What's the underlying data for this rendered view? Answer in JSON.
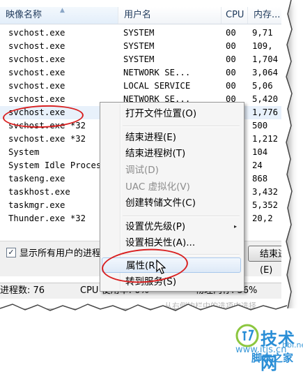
{
  "columns": {
    "name": "映像名称",
    "user": "用户名",
    "cpu": "CPU",
    "mem": "内存..."
  },
  "processes": [
    {
      "name": "svchost.exe",
      "user": "SYSTEM",
      "cpu": "00",
      "mem": "9,71"
    },
    {
      "name": "svchost.exe",
      "user": "SYSTEM",
      "cpu": "00",
      "mem": "109,"
    },
    {
      "name": "svchost.exe",
      "user": "SYSTEM",
      "cpu": "00",
      "mem": "1,704"
    },
    {
      "name": "svchost.exe",
      "user": "NETWORK SE...",
      "cpu": "00",
      "mem": "3,064"
    },
    {
      "name": "svchost.exe",
      "user": "LOCAL SERVICE",
      "cpu": "00",
      "mem": "5,06"
    },
    {
      "name": "svchost.exe",
      "user": "NETWORK SE...",
      "cpu": "00",
      "mem": "5,420"
    },
    {
      "name": "svchost.exe",
      "user": "",
      "cpu": "",
      "mem": "1,776"
    },
    {
      "name": "svchost.exe *32",
      "user": "",
      "cpu": "",
      "mem": "500"
    },
    {
      "name": "svchost.exe *32",
      "user": "",
      "cpu": "",
      "mem": "1,212"
    },
    {
      "name": "System",
      "user": "",
      "cpu": "",
      "mem": "104"
    },
    {
      "name": "System Idle Process",
      "user": "",
      "cpu": "",
      "mem": "24"
    },
    {
      "name": "taskeng.exe",
      "user": "",
      "cpu": "",
      "mem": "868"
    },
    {
      "name": "taskhost.exe",
      "user": "",
      "cpu": "",
      "mem": "3,432"
    },
    {
      "name": "taskmgr.exe",
      "user": "",
      "cpu": "",
      "mem": "5,352"
    },
    {
      "name": "Thunder.exe *32",
      "user": "",
      "cpu": "",
      "mem": "20,2"
    }
  ],
  "show_all_users": {
    "label": "显示所有用户的进程(S)",
    "checked": true,
    "check_glyph": "✓"
  },
  "end_button": "结束进程(E)",
  "status": {
    "processes": "进程数: 76",
    "cpu": "CPU 使用率: 0%",
    "memory": "物理内存: 56%"
  },
  "ghost_text": "从右侧边栏中的选项中选择",
  "context_menu": {
    "items": [
      {
        "label": "打开文件位置(O)"
      },
      {
        "label": "结束进程(E)"
      },
      {
        "label": "结束进程树(T)"
      },
      {
        "label": "调试(D)",
        "disabled": true
      },
      {
        "label": "UAC 虚拟化(V)",
        "disabled": true
      },
      {
        "label": "创建转储文件(C)"
      },
      {
        "label": "设置优先级(P)",
        "submenu": "▸"
      },
      {
        "label": "设置相关性(A)..."
      },
      {
        "label": "属性(R)",
        "hover": true
      },
      {
        "label": "转到服务(S)"
      }
    ]
  },
  "watermark": {
    "brand": "技术网",
    "url": "www.itjs.cn",
    "url_suffix": "bbl.net",
    "home": "脚本之家"
  },
  "colors": {
    "highlight_ring": "#d92020",
    "menu_hover": "#dde9f7",
    "watermark": "#2a8ed6"
  }
}
